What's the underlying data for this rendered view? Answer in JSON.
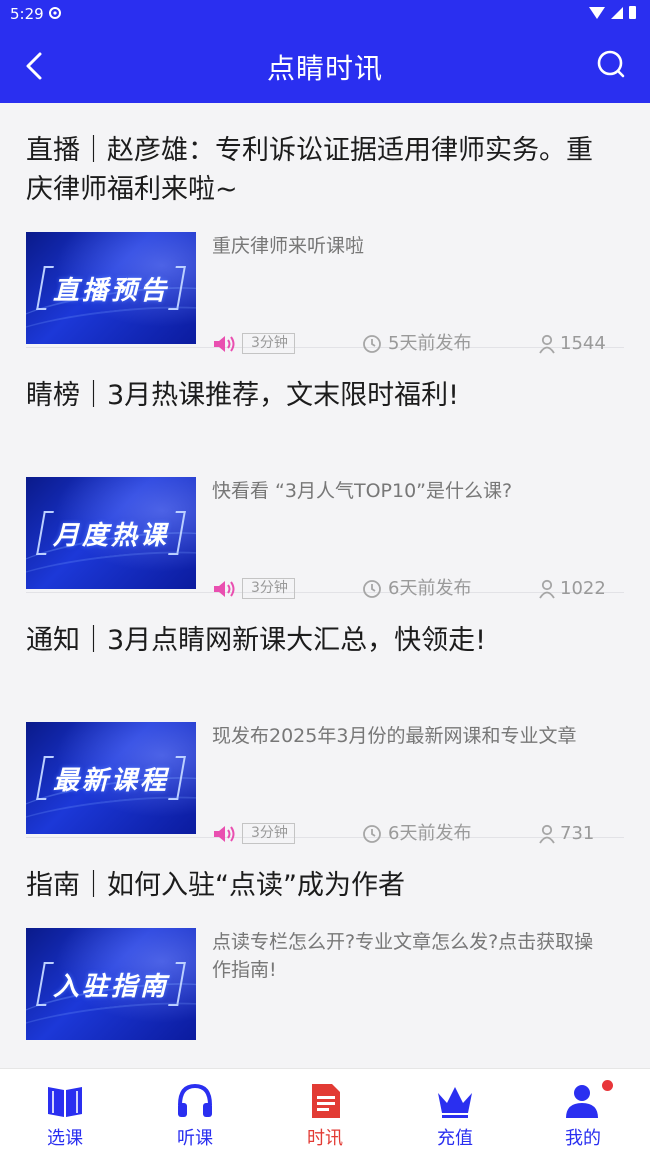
{
  "status_bar": {
    "time": "5:29"
  },
  "header": {
    "title": "点睛时讯"
  },
  "articles": [
    {
      "title": "直播｜赵彦雄：专利诉讼证据适用律师实务。重庆律师福利来啦~",
      "thumb_text": "直播预告",
      "summary": "重庆律师来听课啦",
      "duration": "3分钟",
      "published": "5天前发布",
      "views": "1544"
    },
    {
      "title": "睛榜｜3月热课推荐，文末限时福利!",
      "thumb_text": "月度热课",
      "summary": "快看看 “3月人气TOP10”是什么课?",
      "duration": "3分钟",
      "published": "6天前发布",
      "views": "1022"
    },
    {
      "title": "通知｜3月点睛网新课大汇总，快领走!",
      "thumb_text": "最新课程",
      "summary": "现发布2025年3月份的最新网课和专业文章",
      "duration": "3分钟",
      "published": "6天前发布",
      "views": "731"
    },
    {
      "title": "指南｜如何入驻“点读”成为作者",
      "thumb_text": "入驻指南",
      "summary": "点读专栏怎么开?专业文章怎么发?点击获取操作指南!"
    }
  ],
  "bottom_nav": [
    {
      "label": "选课",
      "icon": "book-icon"
    },
    {
      "label": "听课",
      "icon": "headphones-icon"
    },
    {
      "label": "时讯",
      "icon": "document-icon",
      "active": true
    },
    {
      "label": "充值",
      "icon": "crown-icon"
    },
    {
      "label": "我的",
      "icon": "user-icon",
      "badge": true
    }
  ],
  "colors": {
    "primary": "#2a2ff0",
    "active": "#e23b34",
    "speaker": "#e94fb0"
  }
}
